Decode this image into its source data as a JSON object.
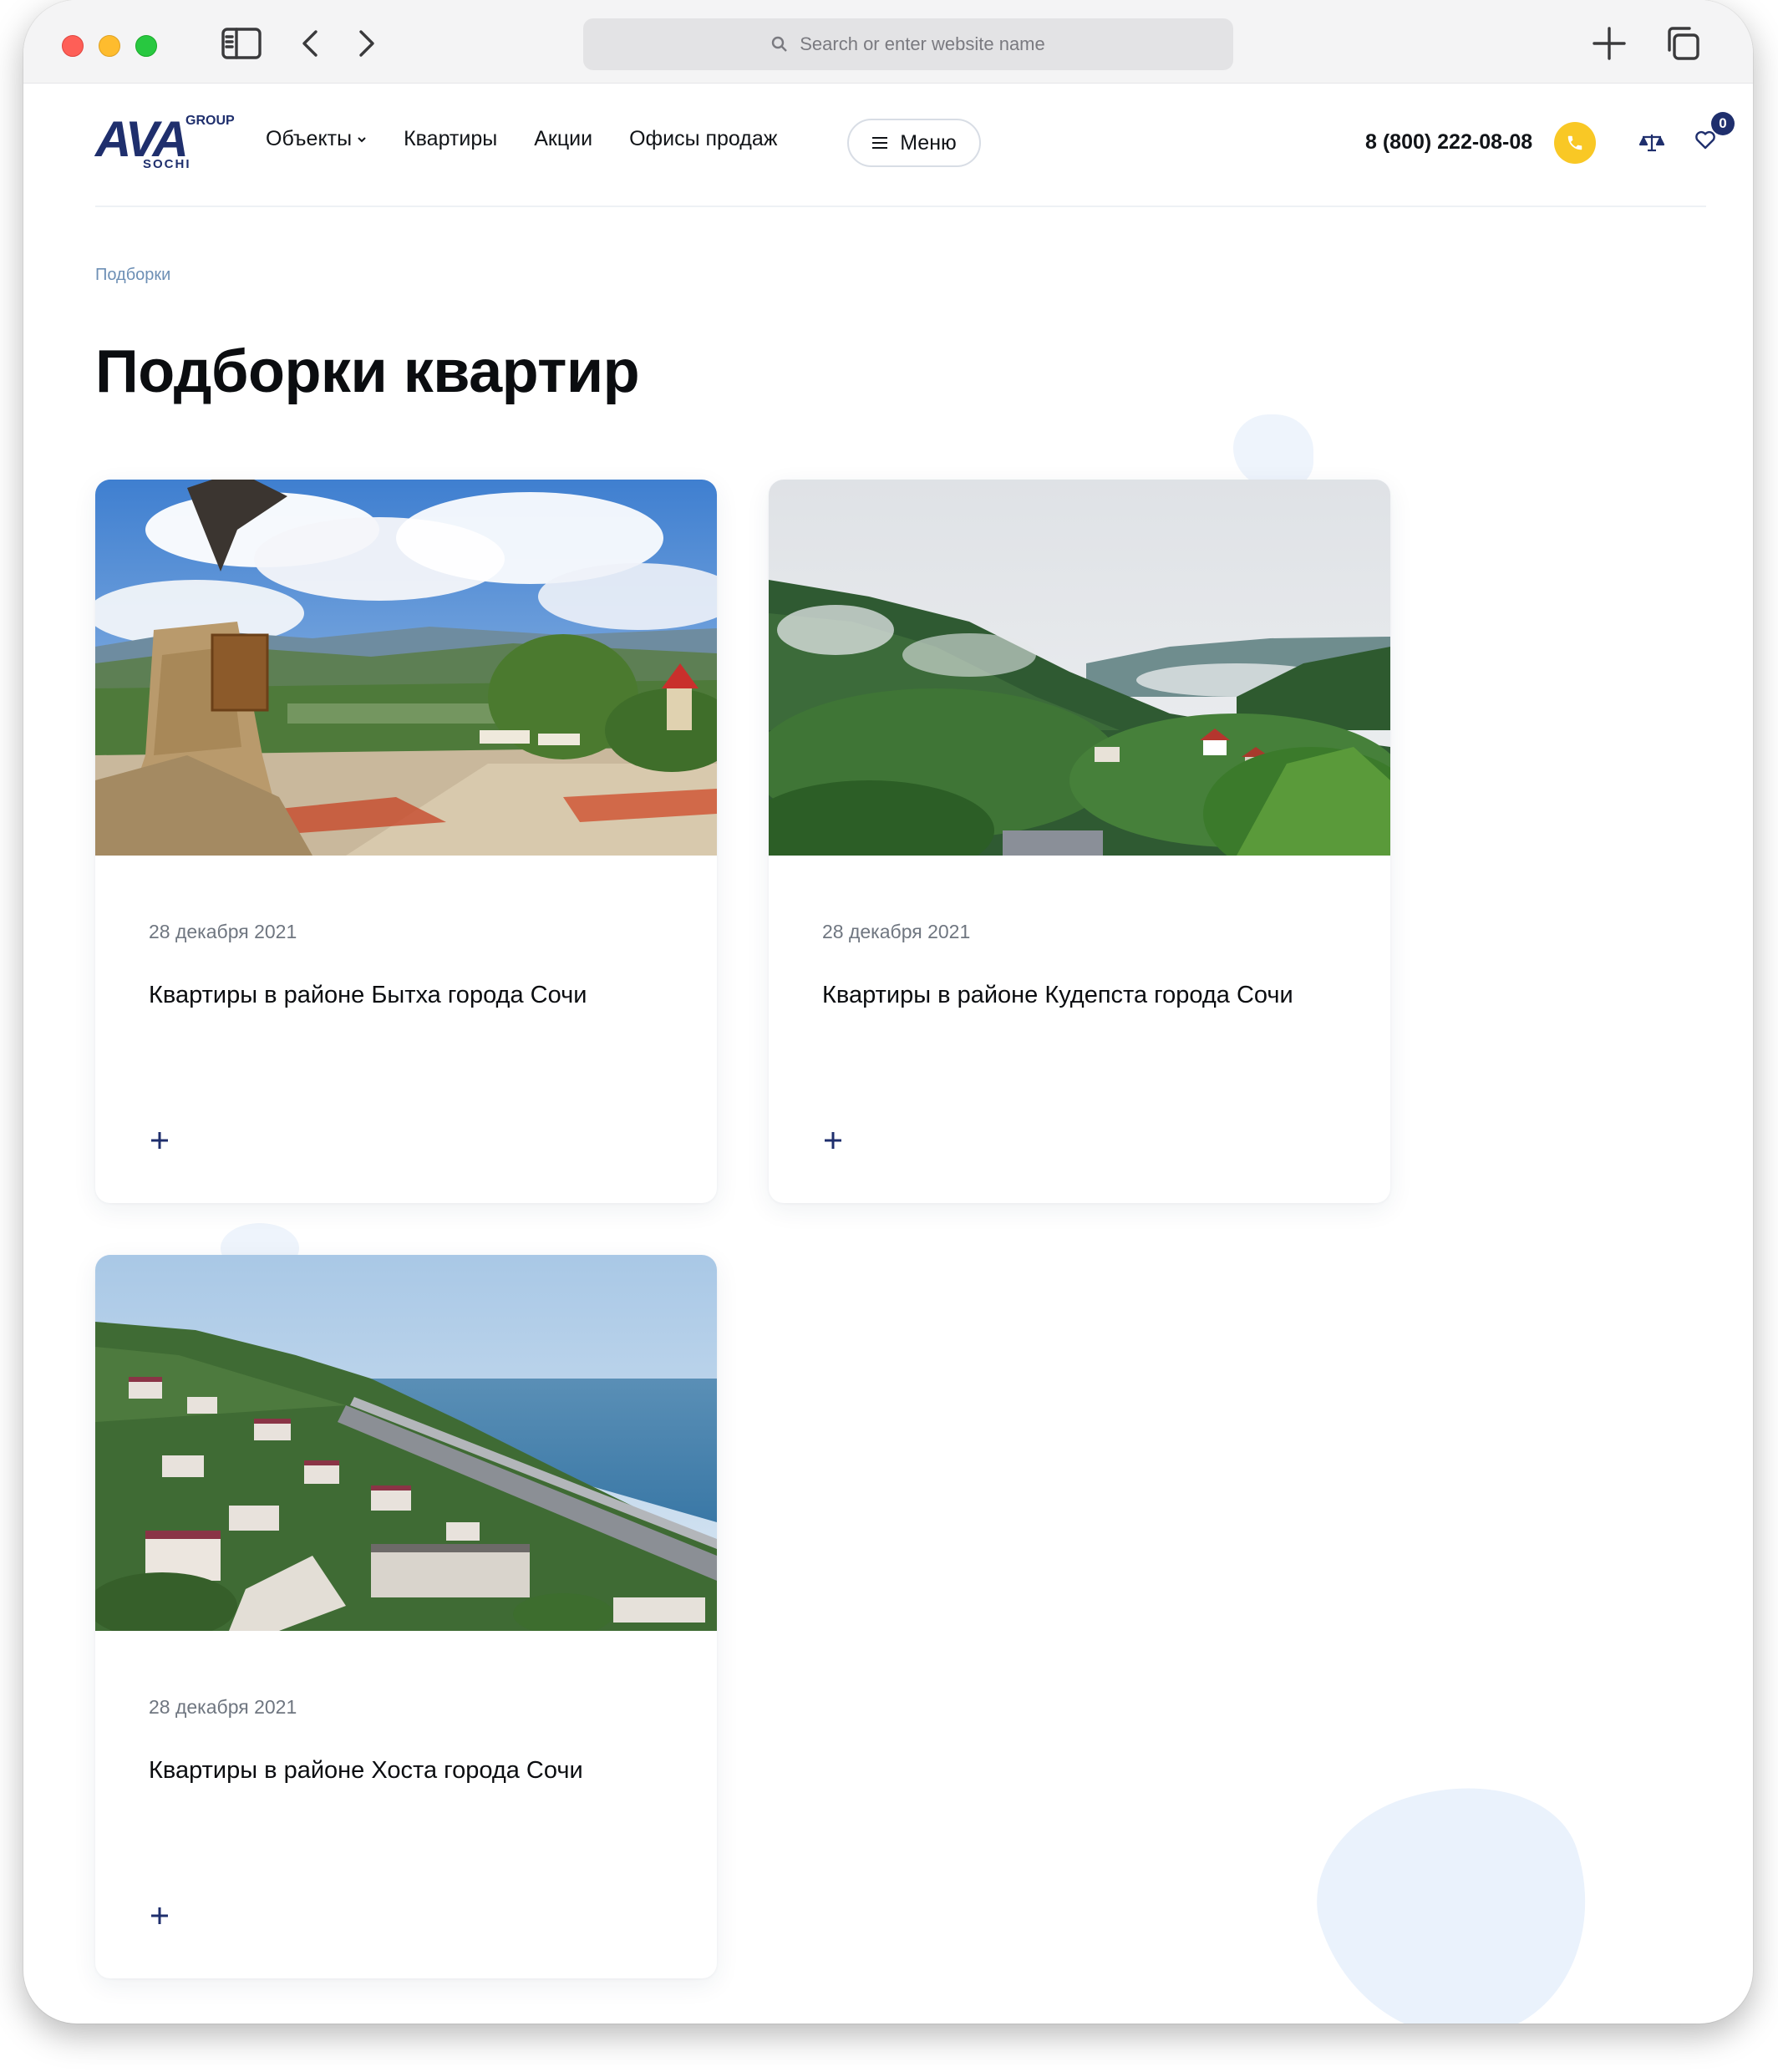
{
  "browser": {
    "address_placeholder": "Search or enter website name"
  },
  "header": {
    "logo": {
      "main": "AVA",
      "group": "GROUP",
      "city": "SOCHI"
    },
    "nav": [
      {
        "label": "Объекты",
        "has_dropdown": true
      },
      {
        "label": "Квартиры"
      },
      {
        "label": "Акции"
      },
      {
        "label": "Офисы продаж"
      }
    ],
    "menu_label": "Меню",
    "phone": "8 (800) 222-08-08",
    "favorites_count": "0"
  },
  "breadcrumb": "Подборки",
  "page_title": "Подборки квартир",
  "cards": [
    {
      "date": "28 декабря 2021",
      "title": "Квартиры в районе Бытха города Сочи",
      "image": "eagle-monument-mountains"
    },
    {
      "date": "28 декабря 2021",
      "title": "Квартиры в районе Кудепста города Сочи",
      "image": "misty-green-hills"
    },
    {
      "date": "28 декабря 2021",
      "title": "Квартиры в районе Хоста города Сочи",
      "image": "coastal-town-sea"
    }
  ],
  "colors": {
    "brand": "#1f2f6d",
    "accent": "#f9c825",
    "breadcrumb": "#6d8fb5",
    "blob": "#eef4fc"
  }
}
